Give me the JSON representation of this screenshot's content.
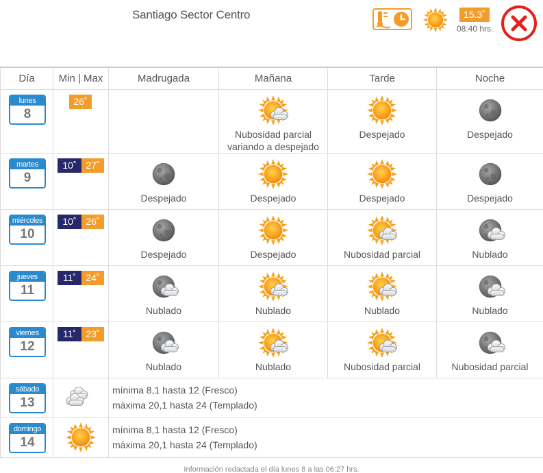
{
  "header": {
    "location": "Santiago Sector Centro",
    "current_temp": "15.3˚",
    "current_time": "08:40 hrs.",
    "current_icon": "sun-icon",
    "calendar_icon": "temperature-clock-icon",
    "close_icon": "close-icon"
  },
  "colors": {
    "accent_orange": "#f39c2a",
    "min_navy": "#27286a",
    "day_blue": "#2a8ad0",
    "close_red": "#e2231a"
  },
  "columns": {
    "day": "Día",
    "minmax": "Min | Max",
    "madrugada": "Madrugada",
    "manana": "Mañana",
    "tarde": "Tarde",
    "noche": "Noche"
  },
  "days": [
    {
      "name": "lunes",
      "num": "8",
      "min": "",
      "max": "26˚",
      "madrugada": null,
      "manana": {
        "icon": "sun-cloud-icon",
        "text": "Nubosidad parcial variando a despejado"
      },
      "tarde": {
        "icon": "sun-icon",
        "text": "Despejado"
      },
      "noche": {
        "icon": "moon-icon",
        "text": "Despejado"
      }
    },
    {
      "name": "martes",
      "num": "9",
      "min": "10˚",
      "max": "27˚",
      "madrugada": {
        "icon": "moon-icon",
        "text": "Despejado"
      },
      "manana": {
        "icon": "sun-icon",
        "text": "Despejado"
      },
      "tarde": {
        "icon": "sun-icon",
        "text": "Despejado"
      },
      "noche": {
        "icon": "moon-icon",
        "text": "Despejado"
      }
    },
    {
      "name": "miércoles",
      "num": "10",
      "min": "10˚",
      "max": "26˚",
      "madrugada": {
        "icon": "moon-icon",
        "text": "Despejado"
      },
      "manana": {
        "icon": "sun-icon",
        "text": "Despejado"
      },
      "tarde": {
        "icon": "sun-cloud-icon",
        "text": "Nubosidad parcial"
      },
      "noche": {
        "icon": "moon-cloud-icon",
        "text": "Nublado"
      }
    },
    {
      "name": "jueves",
      "num": "11",
      "min": "11˚",
      "max": "24˚",
      "madrugada": {
        "icon": "moon-cloud-icon",
        "text": "Nublado"
      },
      "manana": {
        "icon": "sun-cloud-icon",
        "text": "Nublado"
      },
      "tarde": {
        "icon": "sun-cloud-icon",
        "text": "Nublado"
      },
      "noche": {
        "icon": "moon-cloud-icon",
        "text": "Nublado"
      }
    },
    {
      "name": "viernes",
      "num": "12",
      "min": "11˚",
      "max": "23˚",
      "madrugada": {
        "icon": "moon-cloud-icon",
        "text": "Nublado"
      },
      "manana": {
        "icon": "sun-cloud-icon",
        "text": "Nublado"
      },
      "tarde": {
        "icon": "sun-cloud-icon",
        "text": "Nubosidad parcial"
      },
      "noche": {
        "icon": "moon-cloud-icon",
        "text": "Nubosidad parcial"
      }
    }
  ],
  "extended": [
    {
      "name": "sábado",
      "num": "13",
      "icon": "clouds-icon",
      "line1": "mínima 8,1 hasta 12 (Fresco)",
      "line2": "máxima 20,1 hasta 24 (Templado)"
    },
    {
      "name": "domingo",
      "num": "14",
      "icon": "sun-icon",
      "line1": "mínima 8,1 hasta 12 (Fresco)",
      "line2": "máxima 20,1 hasta 24 (Templado)"
    }
  ],
  "footer": "Información redactada el día lunes 8 a las 06:27 hrs."
}
